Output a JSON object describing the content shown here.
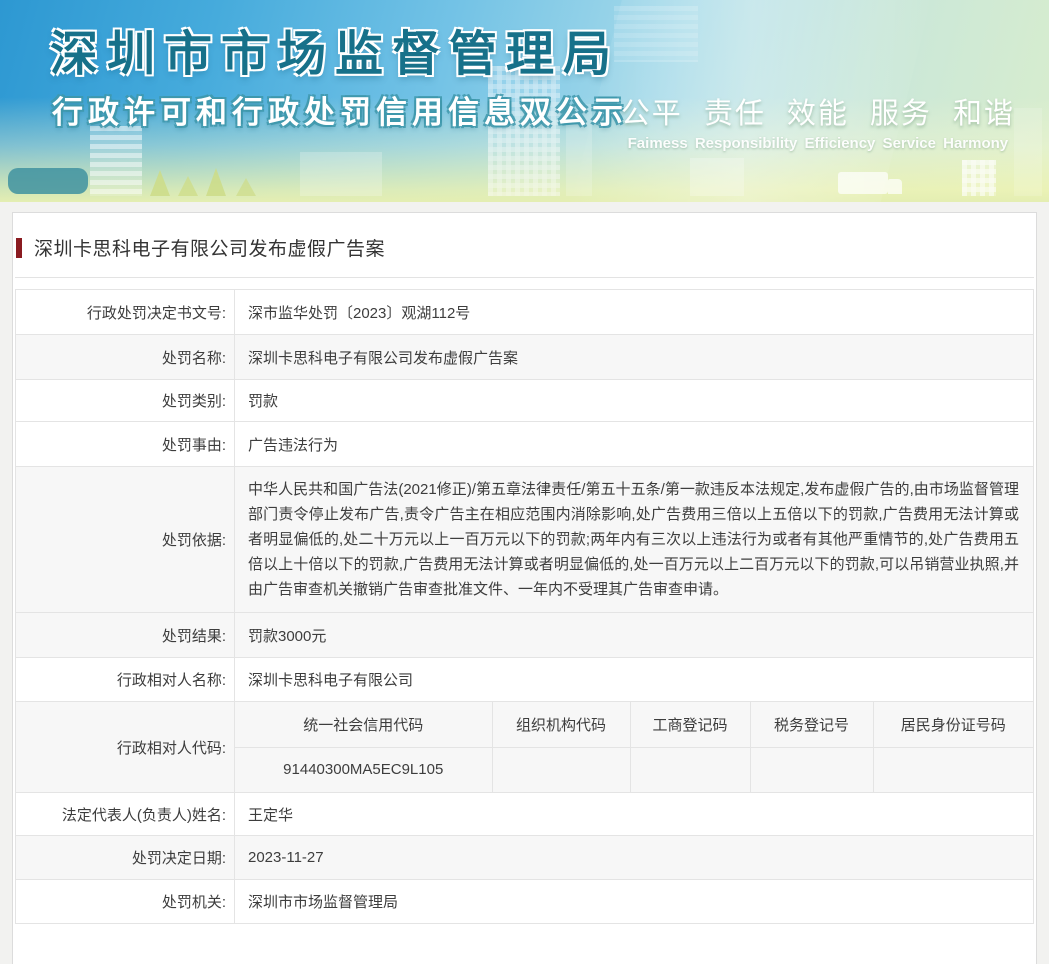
{
  "banner": {
    "title": "深圳市市场监督管理局",
    "subtitle": "行政许可和行政处罚信用信息双公示",
    "slogan_cn": "公平 责任 效能 服务 和谐",
    "slogan_en": "Faimess Responsibility Efficiency Service Harmony"
  },
  "page": {
    "title": "深圳卡思科电子有限公司发布虚假广告案",
    "accent_bar_color": "#8a1b20"
  },
  "table": {
    "rows": [
      {
        "label": "行政处罚决定书文号:",
        "value": "深市监华处罚〔2023〕观湖112号"
      },
      {
        "label": "处罚名称:",
        "value": "深圳卡思科电子有限公司发布虚假广告案"
      },
      {
        "label": "处罚类别:",
        "value": "罚款"
      },
      {
        "label": "处罚事由:",
        "value": "广告违法行为"
      },
      {
        "label": "处罚依据:",
        "value": "中华人民共和国广告法(2021修正)/第五章法律责任/第五十五条/第一款违反本法规定,发布虚假广告的,由市场监督管理部门责令停止发布广告,责令广告主在相应范围内消除影响,处广告费用三倍以上五倍以下的罚款,广告费用无法计算或者明显偏低的,处二十万元以上一百万元以下的罚款;两年内有三次以上违法行为或者有其他严重情节的,处广告费用五倍以上十倍以下的罚款,广告费用无法计算或者明显偏低的,处一百万元以上二百万元以下的罚款,可以吊销营业执照,并由广告审查机关撤销广告审查批准文件、一年内不受理其广告审查申请。"
      },
      {
        "label": "处罚结果:",
        "value": "罚款3000元"
      },
      {
        "label": "行政相对人名称:",
        "value": "深圳卡思科电子有限公司"
      },
      {
        "label": "法定代表人(负责人)姓名:",
        "value": "王定华"
      },
      {
        "label": "处罚决定日期:",
        "value": "2023-11-27"
      },
      {
        "label": "处罚机关:",
        "value": "深圳市市场监督管理局"
      }
    ],
    "code_row": {
      "label": "行政相对人代码:",
      "columns": [
        "统一社会信用代码",
        "组织机构代码",
        "工商登记码",
        "税务登记号",
        "居民身份证号码"
      ],
      "values": [
        "91440300MA5EC9L105",
        "",
        "",
        "",
        ""
      ]
    }
  }
}
